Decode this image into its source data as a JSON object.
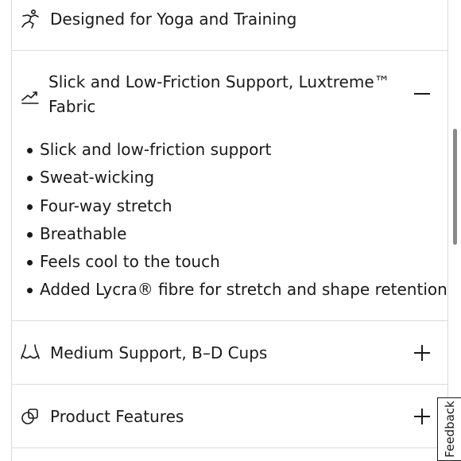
{
  "rows": [
    {
      "title": "Designed for Yoga and Training",
      "icon": "yoga-pose-icon"
    },
    {
      "title_line1": "Slick and Low-Friction Support, Luxtreme™",
      "title_line2": "Fabric",
      "icon": "fabric-slide-icon",
      "toggle": "minus",
      "expanded": true
    },
    {
      "title": "Medium Support, B–D Cups",
      "icon": "bra-support-icon",
      "toggle": "plus",
      "expanded": false
    },
    {
      "title": "Product Features",
      "icon": "product-features-icon",
      "toggle": "plus",
      "expanded": false
    }
  ],
  "features": [
    "Slick and low-friction support",
    "Sweat-wicking",
    "Four-way stretch",
    "Breathable",
    "Feels cool to the touch",
    "Added Lycra® fibre for stretch and shape retention"
  ],
  "feedback": {
    "label": "Feedback"
  },
  "colors": {
    "text": "#1a1a1a",
    "divider": "#dcdcdc",
    "background": "#ffffff"
  }
}
